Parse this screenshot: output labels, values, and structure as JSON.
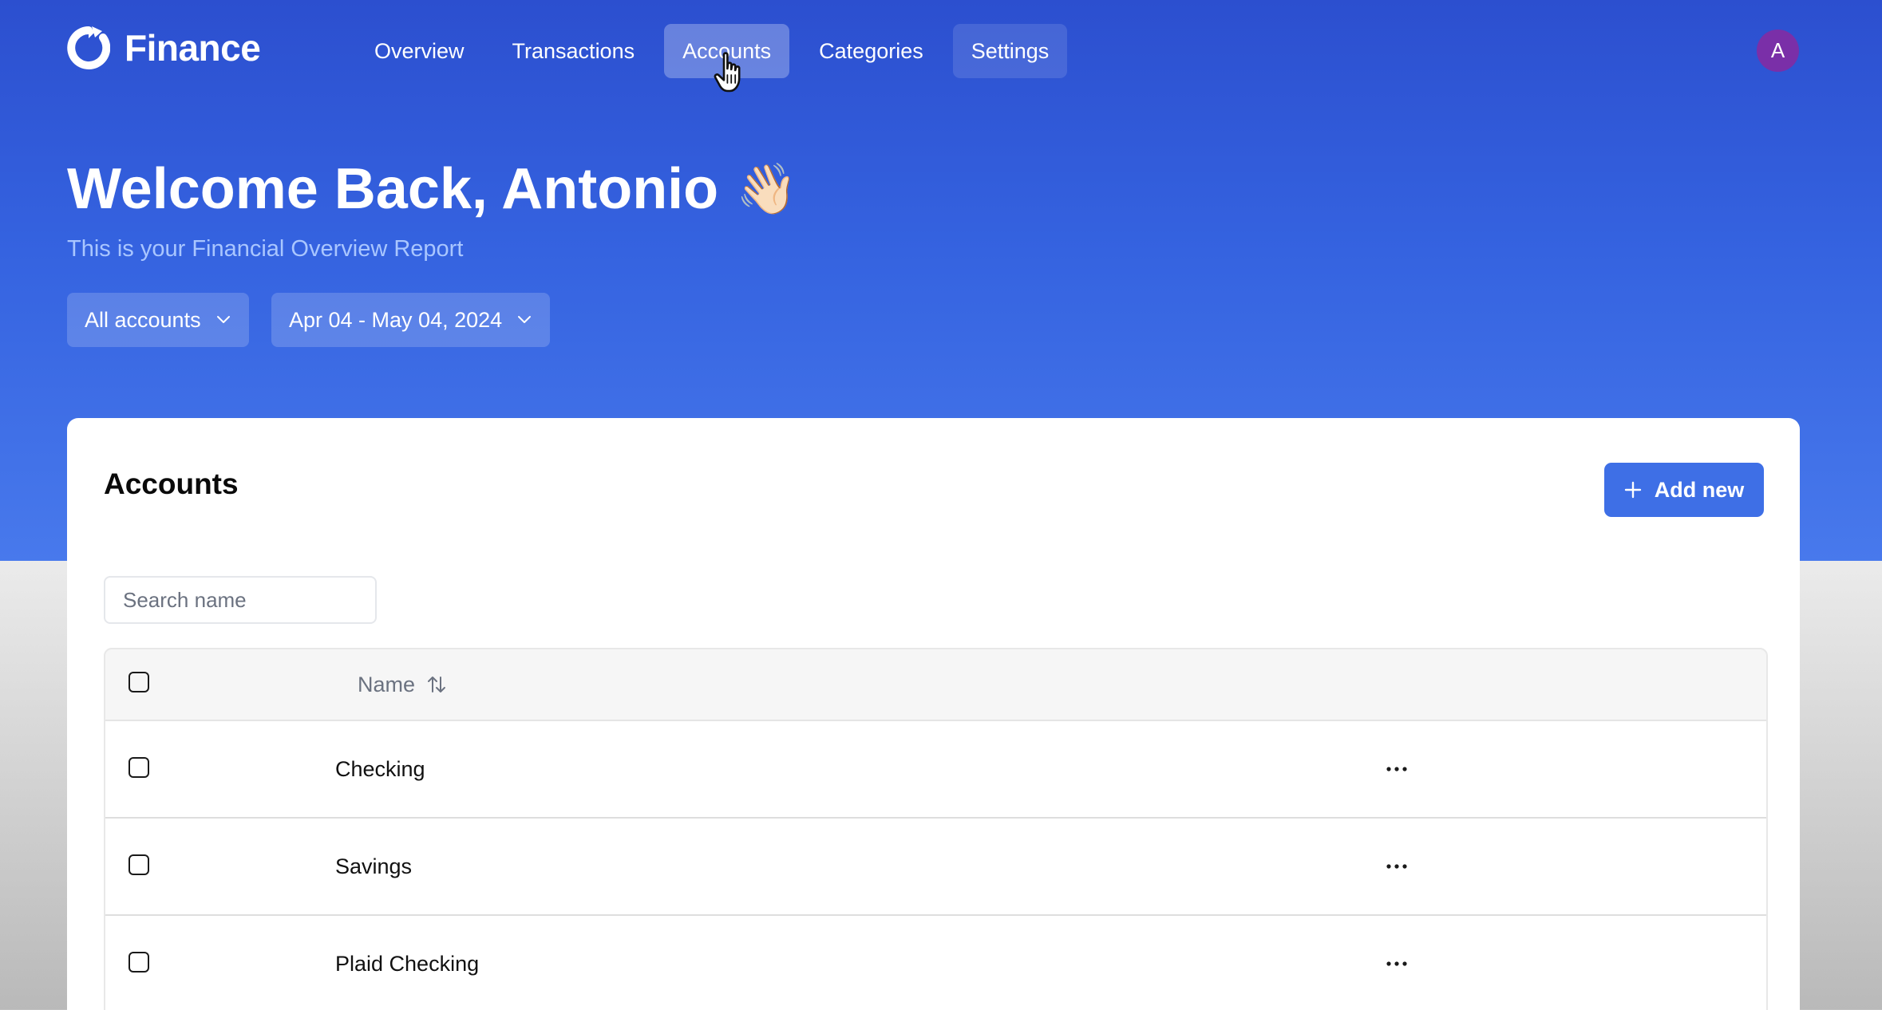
{
  "brand": {
    "name": "Finance",
    "logo_icon": "finance-logo-icon"
  },
  "nav": {
    "items": [
      {
        "label": "Overview",
        "state": "default"
      },
      {
        "label": "Transactions",
        "state": "default"
      },
      {
        "label": "Accounts",
        "state": "active"
      },
      {
        "label": "Categories",
        "state": "default"
      },
      {
        "label": "Settings",
        "state": "hover"
      }
    ]
  },
  "user": {
    "avatar_initial": "A"
  },
  "hero": {
    "greeting": "Welcome Back, Antonio",
    "greeting_emoji": "👋🏻",
    "subtitle": "This is your Financial Overview Report"
  },
  "filters": {
    "account": "All accounts",
    "date_range": "Apr 04 - May 04, 2024"
  },
  "accounts_card": {
    "title": "Accounts",
    "add_button_label": "Add new",
    "search_placeholder": "Search name",
    "table": {
      "columns": [
        "Name"
      ],
      "rows": [
        {
          "name": "Checking"
        },
        {
          "name": "Savings"
        },
        {
          "name": "Plaid Checking"
        }
      ]
    }
  },
  "colors": {
    "hero_top": "#2c4fcf",
    "hero_bottom": "#4879ec",
    "accent_button": "#3e6fe6",
    "avatar": "#7a2fa8",
    "subtitle": "#a9c6ff"
  }
}
